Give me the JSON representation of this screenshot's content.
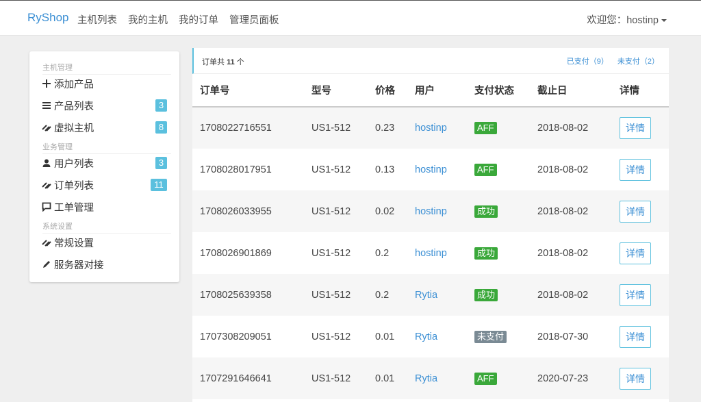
{
  "nav": {
    "brand": "RyShop",
    "links": [
      "主机列表",
      "我的主机",
      "我的订单",
      "管理员面板"
    ],
    "user": "欢迎您：hostinp"
  },
  "sidebar": {
    "sections": [
      "主机管理",
      "业务管理",
      "系统设置"
    ],
    "items": [
      {
        "label": "添加产品",
        "icon": "plus-icon"
      },
      {
        "label": "产品列表",
        "icon": "list-icon",
        "badge": "3"
      },
      {
        "label": "虚拟主机",
        "icon": "link-icon",
        "badge": "8"
      },
      {
        "label": "用户列表",
        "icon": "user-icon",
        "badge": "3"
      },
      {
        "label": "订单列表",
        "icon": "link-icon",
        "badge": "11"
      },
      {
        "label": "工单管理",
        "icon": "comment-icon"
      },
      {
        "label": "常规设置",
        "icon": "link-icon"
      },
      {
        "label": "服务器对接",
        "icon": "pencil-icon"
      }
    ]
  },
  "panel": {
    "count_prefix": "订单共",
    "count": "11",
    "count_suffix": "个",
    "filter_paid": "已支付（9）",
    "filter_unpaid": "未支付（2）"
  },
  "table": {
    "headers": [
      "订单号",
      "型号",
      "价格",
      "用户",
      "支付状态",
      "截止日",
      "详情"
    ],
    "rows": [
      {
        "order": "1708022716551",
        "model": "US1-512",
        "price": "0.23",
        "user": "hostinp",
        "status": "AFF",
        "due": "2018-08-02",
        "action": "详情"
      },
      {
        "order": "1708028017951",
        "model": "US1-512",
        "price": "0.13",
        "user": "hostinp",
        "status": "AFF",
        "due": "2018-08-02",
        "action": "详情"
      },
      {
        "order": "1708026033955",
        "model": "US1-512",
        "price": "0.02",
        "user": "hostinp",
        "status": "成功",
        "due": "2018-08-02",
        "action": "详情"
      },
      {
        "order": "1708026901869",
        "model": "US1-512",
        "price": "0.2",
        "user": "hostinp",
        "status": "成功",
        "due": "2018-08-02",
        "action": "详情"
      },
      {
        "order": "1708025639358",
        "model": "US1-512",
        "price": "0.2",
        "user": "Rytia",
        "status": "成功",
        "due": "2018-08-02",
        "action": "详情"
      },
      {
        "order": "1707308209051",
        "model": "US1-512",
        "price": "0.01",
        "user": "Rytia",
        "status": "未支付",
        "due": "2018-07-30",
        "action": "详情"
      },
      {
        "order": "1707291646641",
        "model": "US1-512",
        "price": "0.01",
        "user": "Rytia",
        "status": "AFF",
        "due": "2020-07-23",
        "action": "详情"
      }
    ]
  },
  "colors": {
    "accent": "#3b8fd4",
    "badge": "#5bc0de",
    "status_success": "#3aa83a",
    "status_unpaid": "#7a8a94"
  }
}
